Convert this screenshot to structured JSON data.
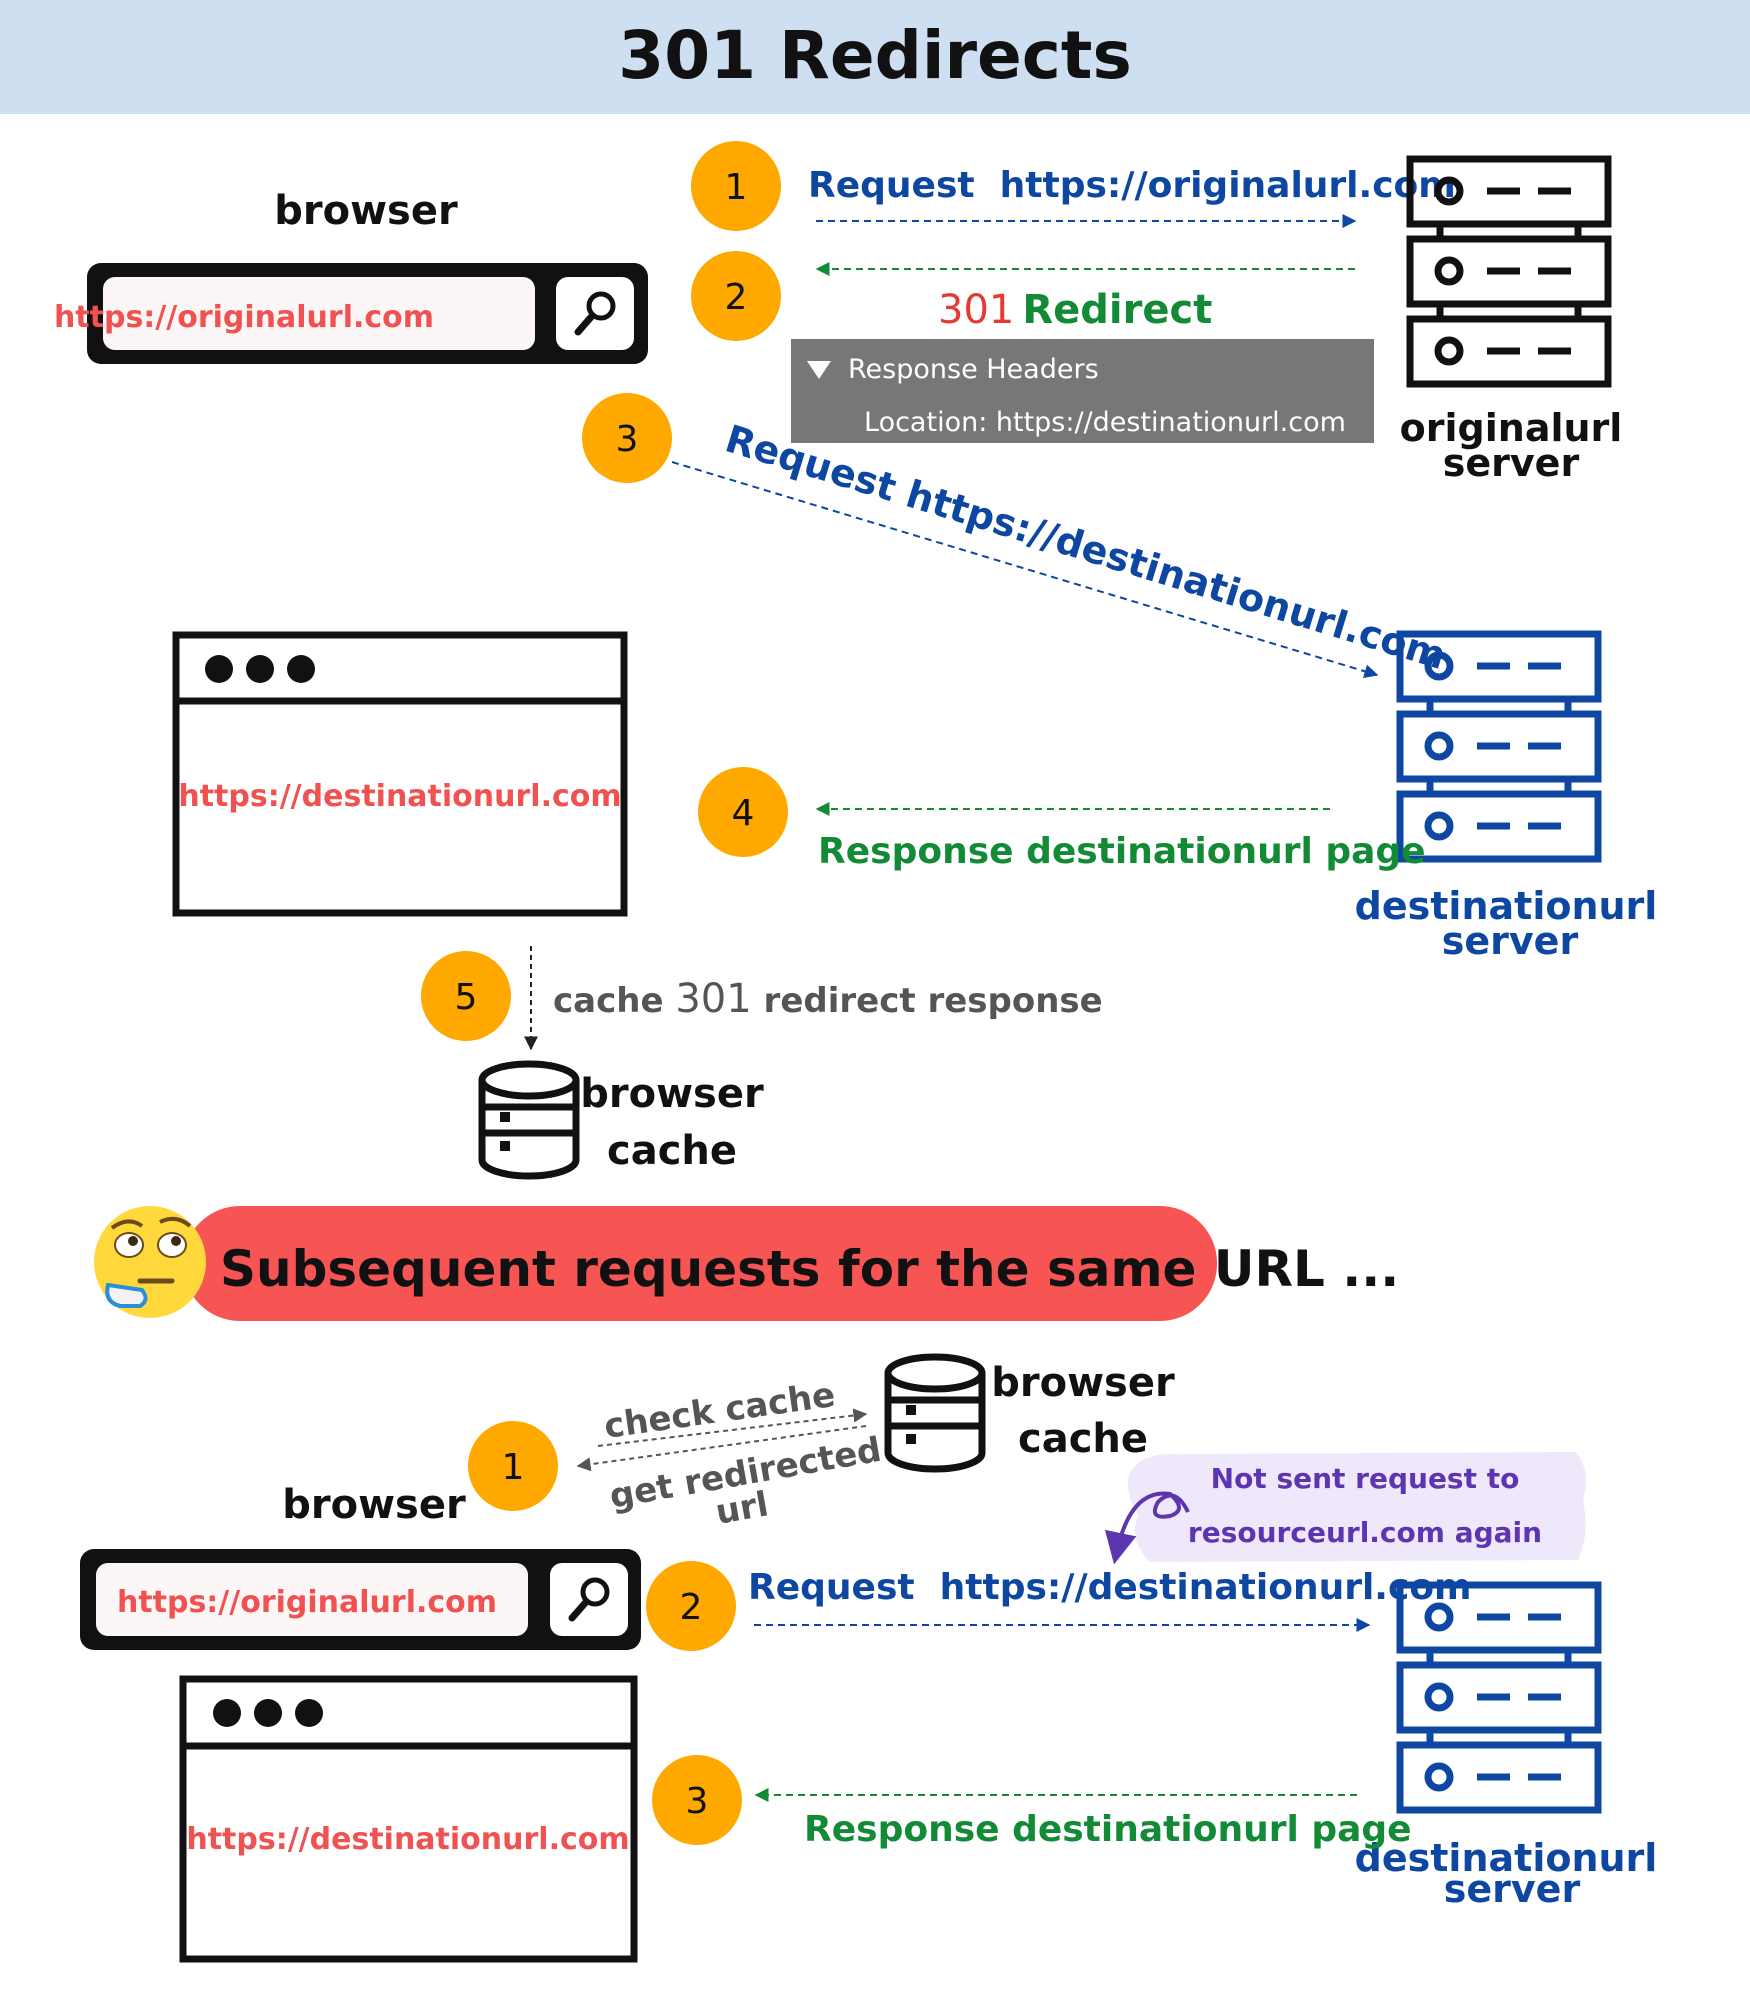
{
  "title": "301 Redirects",
  "colors": {
    "header_bg": "#cfdff2",
    "step_circle": "#ffa800",
    "request_blue": "#0d47a1",
    "response_green": "#138a36",
    "url_red": "#f05252",
    "redirect_red": "#e53935",
    "banner_red": "#f75454",
    "headers_panel": "#777777",
    "note_bg": "#efe8fb",
    "note_text": "#5e35b1",
    "caption_gray": "#555555"
  },
  "top": {
    "browser_label": "browser",
    "address_bar_url": "https://originalurl.com",
    "search_icon": "magnifier-icon",
    "steps": {
      "s1": {
        "num": "1",
        "label": "Request  https://originalurl.com"
      },
      "s2": {
        "num": "2",
        "status_code": "301",
        "status_text": "Redirect",
        "headers_title": "Response Headers",
        "location_line": "Location: https://destinationurl.com"
      },
      "s3": {
        "num": "3",
        "label": "Request https://destinationurl.com"
      },
      "s4": {
        "num": "4",
        "label": "Response destinationurl page"
      },
      "s5": {
        "num": "5",
        "label_prefix": "cache ",
        "label_code": "301",
        "label_suffix": " redirect response"
      }
    },
    "origin_server_label": [
      "originalurl",
      "server"
    ],
    "dest_server_label": [
      "destinationurl",
      "server"
    ],
    "page_window_url": "https://destinationurl.com",
    "cache_label": [
      "browser",
      "cache"
    ]
  },
  "banner": {
    "emoji": "thinking-face-icon",
    "text": "Subsequent requests for the same URL ..."
  },
  "bottom": {
    "step1_num": "1",
    "check_cache": "check cache",
    "get_redirected": [
      "get redirected",
      "url"
    ],
    "cache_label": [
      "browser",
      "cache"
    ],
    "browser_label": "browser",
    "address_bar_url": "https://originalurl.com",
    "note": [
      "Not sent request to",
      "resourceurl.com again"
    ],
    "step2": {
      "num": "2",
      "label": "Request  https://destinationurl.com"
    },
    "step3": {
      "num": "3",
      "label": "Response destinationurl page"
    },
    "page_window_url": "https://destinationurl.com",
    "dest_server_label": [
      "destinationurl",
      "server"
    ]
  }
}
